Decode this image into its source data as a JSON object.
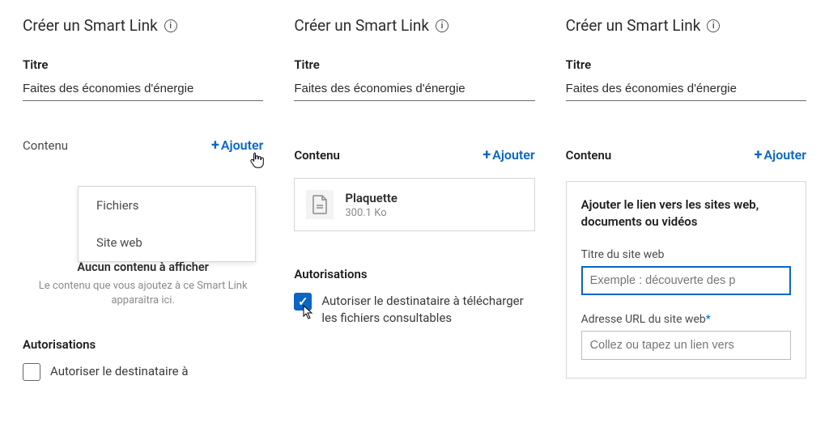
{
  "heading": "Créer un Smart Link",
  "titre_label": "Titre",
  "titre_value": "Faites des économies d'énergie",
  "contenu_label": "Contenu",
  "ajouter_label": "Ajouter",
  "panel1": {
    "dropdown": {
      "files": "Fichiers",
      "website": "Site web"
    },
    "empty_title": "Aucun contenu à afficher",
    "empty_sub": "Le contenu que vous ajoutez à ce Smart Link apparaîtra ici.",
    "auth_heading": "Autorisations",
    "checkbox_label": "Autoriser le destinataire à"
  },
  "panel2": {
    "file_name": "Plaquette",
    "file_size": "300.1 Ko",
    "auth_heading": "Autorisations",
    "checkbox_label": "Autoriser le destinataire à télécharger les fichiers consultables"
  },
  "panel3": {
    "card_heading": "Ajouter le lien vers les sites web, documents ou vidéos",
    "site_title_label": "Titre du site web",
    "site_title_placeholder": "Exemple : découverte des p",
    "site_url_label": "Adresse URL du site web",
    "site_url_placeholder": "Collez ou tapez un lien vers"
  }
}
